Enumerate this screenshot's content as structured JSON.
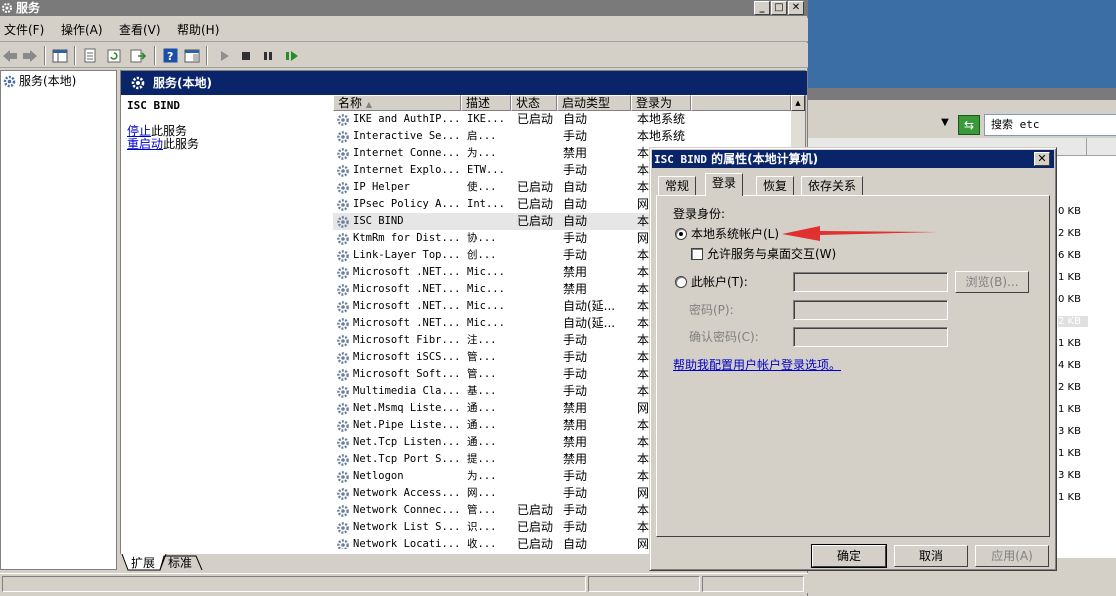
{
  "window": {
    "title": "服务",
    "min": "_",
    "max": "□",
    "close": "✕"
  },
  "menu": [
    "文件(F)",
    "操作(A)",
    "查看(V)",
    "帮助(H)"
  ],
  "tree": {
    "root": "服务(本地)"
  },
  "results": {
    "header": "服务(本地)",
    "selected_name": "ISC BIND",
    "stop_link_action": "停止",
    "stop_link_rest": "此服务",
    "restart_link_action": "重启动",
    "restart_link_rest": "此服务"
  },
  "columns": [
    "名称",
    "描述",
    "状态",
    "启动类型",
    "登录为"
  ],
  "services": [
    {
      "name": "IKE and AuthIP...",
      "desc": "IKE...",
      "status": "已启动",
      "startup": "自动",
      "logon": "本地系统"
    },
    {
      "name": "Interactive Se...",
      "desc": "启...",
      "status": "",
      "startup": "手动",
      "logon": "本地系统"
    },
    {
      "name": "Internet Conne...",
      "desc": "为...",
      "status": "",
      "startup": "禁用",
      "logon": "本"
    },
    {
      "name": "Internet Explo...",
      "desc": "ETW...",
      "status": "",
      "startup": "手动",
      "logon": "本"
    },
    {
      "name": "IP Helper",
      "desc": "使...",
      "status": "已启动",
      "startup": "自动",
      "logon": "本"
    },
    {
      "name": "IPsec Policy A...",
      "desc": "Int...",
      "status": "已启动",
      "startup": "自动",
      "logon": "网"
    },
    {
      "name": "ISC BIND",
      "desc": "",
      "status": "已启动",
      "startup": "自动",
      "logon": "本",
      "selected": true
    },
    {
      "name": "KtmRm for Dist...",
      "desc": "协...",
      "status": "",
      "startup": "手动",
      "logon": "网"
    },
    {
      "name": "Link-Layer Top...",
      "desc": "创...",
      "status": "",
      "startup": "手动",
      "logon": "本"
    },
    {
      "name": "Microsoft .NET...",
      "desc": "Mic...",
      "status": "",
      "startup": "禁用",
      "logon": "本"
    },
    {
      "name": "Microsoft .NET...",
      "desc": "Mic...",
      "status": "",
      "startup": "禁用",
      "logon": "本"
    },
    {
      "name": "Microsoft .NET...",
      "desc": "Mic...",
      "status": "",
      "startup": "自动(延...",
      "logon": "本"
    },
    {
      "name": "Microsoft .NET...",
      "desc": "Mic...",
      "status": "",
      "startup": "自动(延...",
      "logon": "本"
    },
    {
      "name": "Microsoft Fibr...",
      "desc": "注...",
      "status": "",
      "startup": "手动",
      "logon": "本"
    },
    {
      "name": "Microsoft iSCS...",
      "desc": "管...",
      "status": "",
      "startup": "手动",
      "logon": "本"
    },
    {
      "name": "Microsoft Soft...",
      "desc": "管...",
      "status": "",
      "startup": "手动",
      "logon": "本"
    },
    {
      "name": "Multimedia Cla...",
      "desc": "基...",
      "status": "",
      "startup": "手动",
      "logon": "本"
    },
    {
      "name": "Net.Msmq Liste...",
      "desc": "通...",
      "status": "",
      "startup": "禁用",
      "logon": "网"
    },
    {
      "name": "Net.Pipe Liste...",
      "desc": "通...",
      "status": "",
      "startup": "禁用",
      "logon": "本"
    },
    {
      "name": "Net.Tcp Listen...",
      "desc": "通...",
      "status": "",
      "startup": "禁用",
      "logon": "本"
    },
    {
      "name": "Net.Tcp Port S...",
      "desc": "提...",
      "status": "",
      "startup": "禁用",
      "logon": "本"
    },
    {
      "name": "Netlogon",
      "desc": "为...",
      "status": "",
      "startup": "手动",
      "logon": "本"
    },
    {
      "name": "Network Access...",
      "desc": "网...",
      "status": "",
      "startup": "手动",
      "logon": "网"
    },
    {
      "name": "Network Connec...",
      "desc": "管...",
      "status": "已启动",
      "startup": "手动",
      "logon": "本"
    },
    {
      "name": "Network List S...",
      "desc": "识...",
      "status": "已启动",
      "startup": "手动",
      "logon": "本"
    },
    {
      "name": "Network Locati...",
      "desc": "收...",
      "status": "已启动",
      "startup": "自动",
      "logon": "网"
    }
  ],
  "bottom_tabs": [
    "扩展",
    "标准"
  ],
  "dialog": {
    "title_prefix": "ISC BIND",
    "title_rest": " 的属性(本地计算机)",
    "close": "✕",
    "tabs": [
      "常规",
      "登录",
      "恢复",
      "依存关系"
    ],
    "active_tab": "登录",
    "logon_as": "登录身份:",
    "local_system": "本地系统帐户(L)",
    "allow_desktop": "允许服务与桌面交互(W)",
    "this_account": "此帐户(T):",
    "browse": "浏览(B)...",
    "password": "密码(P):",
    "confirm_password": "确认密码(C):",
    "help_link": "帮助我配置用户帐户登录选项。",
    "ok": "确定",
    "cancel": "取消",
    "apply": "应用(A)"
  },
  "background": {
    "search_label": "搜索 etc",
    "sizes": [
      "0 KB",
      "2 KB",
      "6 KB",
      "1 KB",
      "0 KB",
      "2 KB",
      "1 KB",
      "4 KB",
      "2 KB",
      "1 KB",
      "3 KB",
      "1 KB",
      "3 KB",
      "1 KB"
    ]
  },
  "colors": {
    "title_active": "#0a246a",
    "face": "#d4d0c8",
    "link": "#0000cc",
    "arrow": "#e03030",
    "desktop": "#3a6ea5"
  }
}
